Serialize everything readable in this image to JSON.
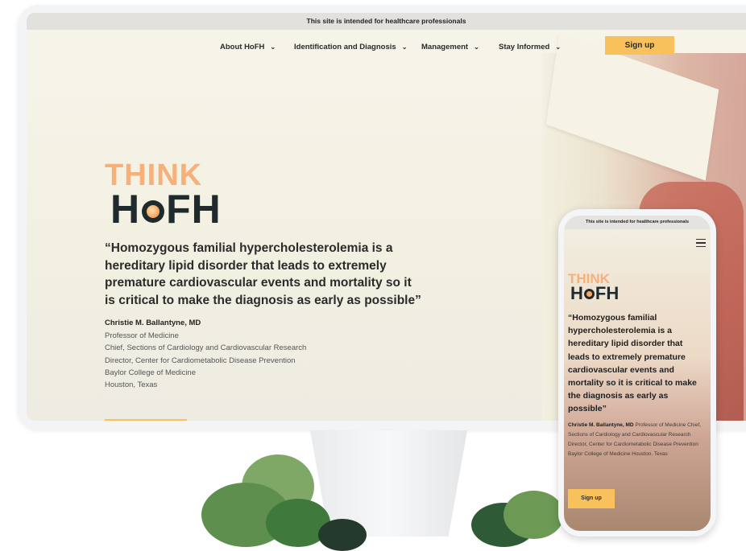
{
  "desktop": {
    "topbar_text": "This site is intended for healthcare professionals",
    "nav": [
      {
        "label": "About HoFH"
      },
      {
        "label": "Identification and Diagnosis"
      },
      {
        "label": "Management"
      },
      {
        "label": "Stay Informed"
      }
    ],
    "signup_label": "Sign up",
    "logo_top": "THINK",
    "logo_h": "H",
    "logo_fh": "FH",
    "quote": "“Homozygous familial hypercholesterolemia is a hereditary lipid disorder that leads to extremely premature cardiovascular events and mortality so it is critical to make the diagnosis as early as possible”",
    "author": "Christie M. Ballantyne, MD",
    "credentials": [
      "Professor of Medicine",
      "Chief, Sections of Cardiology and Cardiovascular Research",
      "Director, Center for Cardiometabolic Disease Prevention",
      "Baylor College of Medicine",
      "Houston, Texas"
    ]
  },
  "mobile": {
    "topbar_text": "This site is intended for healthcare professionals",
    "logo_top": "THINK",
    "logo_h": "H",
    "logo_fh": "FH",
    "quote": "“Homozygous familial hypercholesterolemia is a hereditary lipid disorder that leads to extremely premature cardiovascular events and mortality so it is critical to make the diagnosis as early as possible”",
    "author": "Christie M. Ballantyne, MD",
    "credentials": "Professor of Medicine Chief, Sections of Cardiology and Cardiovascular Research Director, Center for Cardiometabolic Disease Prevention Baylor College of Medicine Houston, Texas",
    "signup_label": "Sign up"
  },
  "colors": {
    "accent": "#f9c15c",
    "logo_orange": "#f7b07a",
    "logo_dark": "#1f2a2e"
  }
}
